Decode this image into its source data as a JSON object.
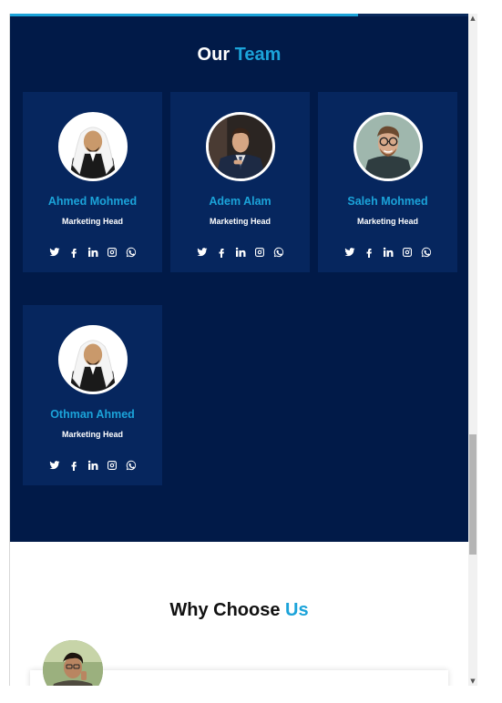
{
  "scroll_progress_percent": 76,
  "team": {
    "title_prefix": "Our",
    "title_accent": "Team",
    "members": [
      {
        "name": "Ahmed Mohmed",
        "role": "Marketing Head",
        "avatar": "ghutra-man-avatar"
      },
      {
        "name": "Adem Alam",
        "role": "Marketing Head",
        "avatar": "suit-man-avatar"
      },
      {
        "name": "Saleh Mohmed",
        "role": "Marketing Head",
        "avatar": "glasses-man-avatar"
      },
      {
        "name": "Othman Ahmed",
        "role": "Marketing Head",
        "avatar": "ghutra-man-avatar"
      }
    ],
    "social_icons": [
      "twitter-icon",
      "facebook-icon",
      "linkedin-icon",
      "instagram-icon",
      "whatsapp-icon"
    ]
  },
  "why": {
    "title_prefix": "Why Choose",
    "title_accent": "Us"
  },
  "colors": {
    "team_background": "#011a48",
    "card_background": "#06265e",
    "accent": "#1ba3d9"
  }
}
